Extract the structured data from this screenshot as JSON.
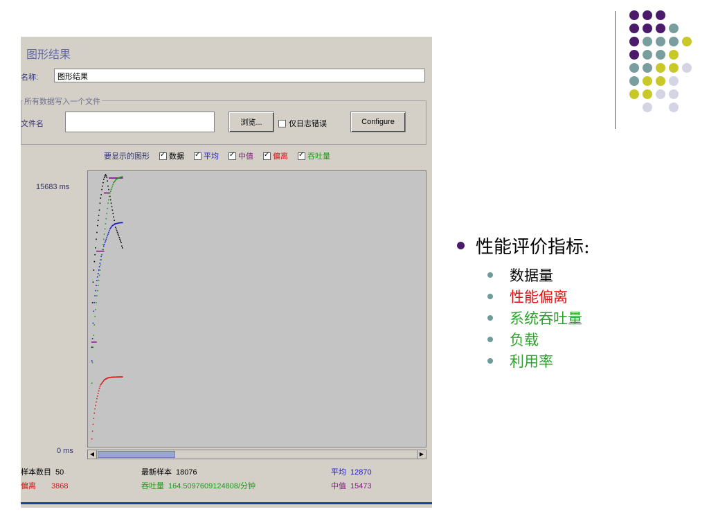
{
  "window": {
    "title": "图形结果",
    "name_label": "名称:",
    "name_value": "图形结果",
    "file_group_legend": "所有数据写入一个文件",
    "file_label": "文件名",
    "file_value": "",
    "browse_label": "浏览...",
    "log_errors_label": "仅日志错误",
    "log_errors_checked": false,
    "configure_label": "Configure"
  },
  "display": {
    "label": "要显示的图形",
    "options": [
      {
        "label": "数据",
        "color": "#000000",
        "checked": true
      },
      {
        "label": "平均",
        "color": "#1a1ad0",
        "checked": true
      },
      {
        "label": "中值",
        "color": "#8a1a8a",
        "checked": true
      },
      {
        "label": "偏离",
        "color": "#d01a1a",
        "checked": true
      },
      {
        "label": "吞吐量",
        "color": "#1a9a1a",
        "checked": true
      }
    ]
  },
  "chart": {
    "y_max_label": "15683 ms",
    "y_min_label": "0 ms"
  },
  "chart_data": {
    "type": "scatter",
    "ylim": [
      0,
      15683
    ],
    "x": [
      1,
      2,
      3,
      4,
      5,
      6,
      7,
      8,
      9,
      10,
      11,
      12,
      13,
      14,
      15,
      16,
      17,
      18,
      19,
      20,
      21,
      22,
      23,
      24,
      25,
      26,
      27,
      28,
      29,
      30,
      31,
      32,
      33,
      34,
      35,
      36,
      37,
      38,
      39,
      40,
      41,
      42,
      43,
      44,
      45,
      46,
      47,
      48,
      49,
      50
    ],
    "series": [
      {
        "name": "数据",
        "color": "#000000",
        "values": [
          5600,
          8200,
          9400,
          10100,
          10600,
          11000,
          11400,
          11900,
          12300,
          12700,
          13000,
          13300,
          13600,
          14000,
          14300,
          14500,
          14800,
          15000,
          15200,
          15400,
          15500,
          15600,
          15683,
          15600,
          15500,
          15300,
          15000,
          14800,
          14600,
          14400,
          14200,
          14000,
          13800,
          13600,
          13400,
          13200,
          13000,
          12800,
          12600,
          12500,
          12400,
          12300,
          12200,
          12100,
          12000,
          11900,
          11800,
          11700,
          11500,
          11400
        ]
      },
      {
        "name": "平均",
        "color": "#1a1ad0",
        "values": [
          4800,
          6100,
          7000,
          7700,
          8200,
          8600,
          8900,
          9200,
          9500,
          9700,
          9900,
          10100,
          10300,
          10500,
          10700,
          10900,
          11000,
          11200,
          11300,
          11500,
          11600,
          11700,
          11800,
          11900,
          12000,
          12100,
          12200,
          12300,
          12400,
          12500,
          12550,
          12600,
          12650,
          12700,
          12720,
          12740,
          12760,
          12780,
          12800,
          12810,
          12820,
          12830,
          12840,
          12850,
          12855,
          12860,
          12862,
          12865,
          12868,
          12870
        ]
      },
      {
        "name": "中值",
        "color": "#8a1a8a",
        "values": [
          5900,
          5900,
          5900,
          5900,
          5900,
          5900,
          5900,
          5900,
          11200,
          11200,
          11200,
          11200,
          11200,
          11200,
          11200,
          11200,
          11200,
          11200,
          11200,
          11200,
          14600,
          14600,
          14600,
          14600,
          14600,
          14600,
          14600,
          14600,
          15473,
          15473,
          15473,
          15473,
          15473,
          15473,
          15473,
          15473,
          15473,
          15473,
          15473,
          15473,
          15473,
          15473,
          15473,
          15473,
          15473,
          15473,
          15473,
          15473,
          15473,
          15473
        ]
      },
      {
        "name": "偏离",
        "color": "#d01a1a",
        "values": [
          250,
          700,
          1100,
          1450,
          1750,
          2000,
          2200,
          2400,
          2600,
          2750,
          2900,
          3050,
          3200,
          3300,
          3400,
          3450,
          3500,
          3550,
          3600,
          3650,
          3700,
          3720,
          3740,
          3760,
          3780,
          3800,
          3810,
          3820,
          3830,
          3840,
          3845,
          3850,
          3852,
          3854,
          3856,
          3858,
          3859,
          3860,
          3861,
          3862,
          3863,
          3864,
          3865,
          3866,
          3866,
          3867,
          3867,
          3868,
          3868,
          3868
        ]
      },
      {
        "name": "吞吐量",
        "color": "#1a9a1a",
        "values": [
          3500,
          4700,
          5600,
          6300,
          6900,
          7400,
          7800,
          8200,
          8600,
          8900,
          9200,
          9500,
          9800,
          10100,
          10400,
          10700,
          11000,
          11300,
          11600,
          11900,
          12200,
          12500,
          12800,
          13100,
          13400,
          13700,
          14000,
          14200,
          14400,
          14600,
          14700,
          14800,
          14900,
          15000,
          15100,
          15200,
          15250,
          15300,
          15350,
          15400,
          15420,
          15440,
          15460,
          15480,
          15500,
          15510,
          15520,
          15530,
          15540,
          15550
        ]
      }
    ]
  },
  "stats": {
    "samples_label": "样本数目",
    "samples_value": "50",
    "latest_label": "最新样本",
    "latest_value": "18076",
    "average_label": "平均",
    "average_value": "12870",
    "deviation_label": "偏离",
    "deviation_value": "3868",
    "throughput_label": "吞吐量",
    "throughput_value": "164.5097609124808/分钟",
    "median_label": "中值",
    "median_value": "15473"
  },
  "slide": {
    "heading": "性能评价指标:",
    "items": [
      {
        "label": "数据量",
        "color": "#000000"
      },
      {
        "label": "性能偏离",
        "color": "#e01010"
      },
      {
        "label": "系统吞吐量",
        "color": "#2ea02e"
      },
      {
        "label": "负载",
        "color": "#2ea02e"
      },
      {
        "label": "利用率",
        "color": "#2ea02e"
      }
    ],
    "palette": {
      "purple": "#4b1a6b",
      "teal": "#7a9e9e",
      "yellow": "#c8c828",
      "lavender": "#d4d4e4"
    }
  }
}
